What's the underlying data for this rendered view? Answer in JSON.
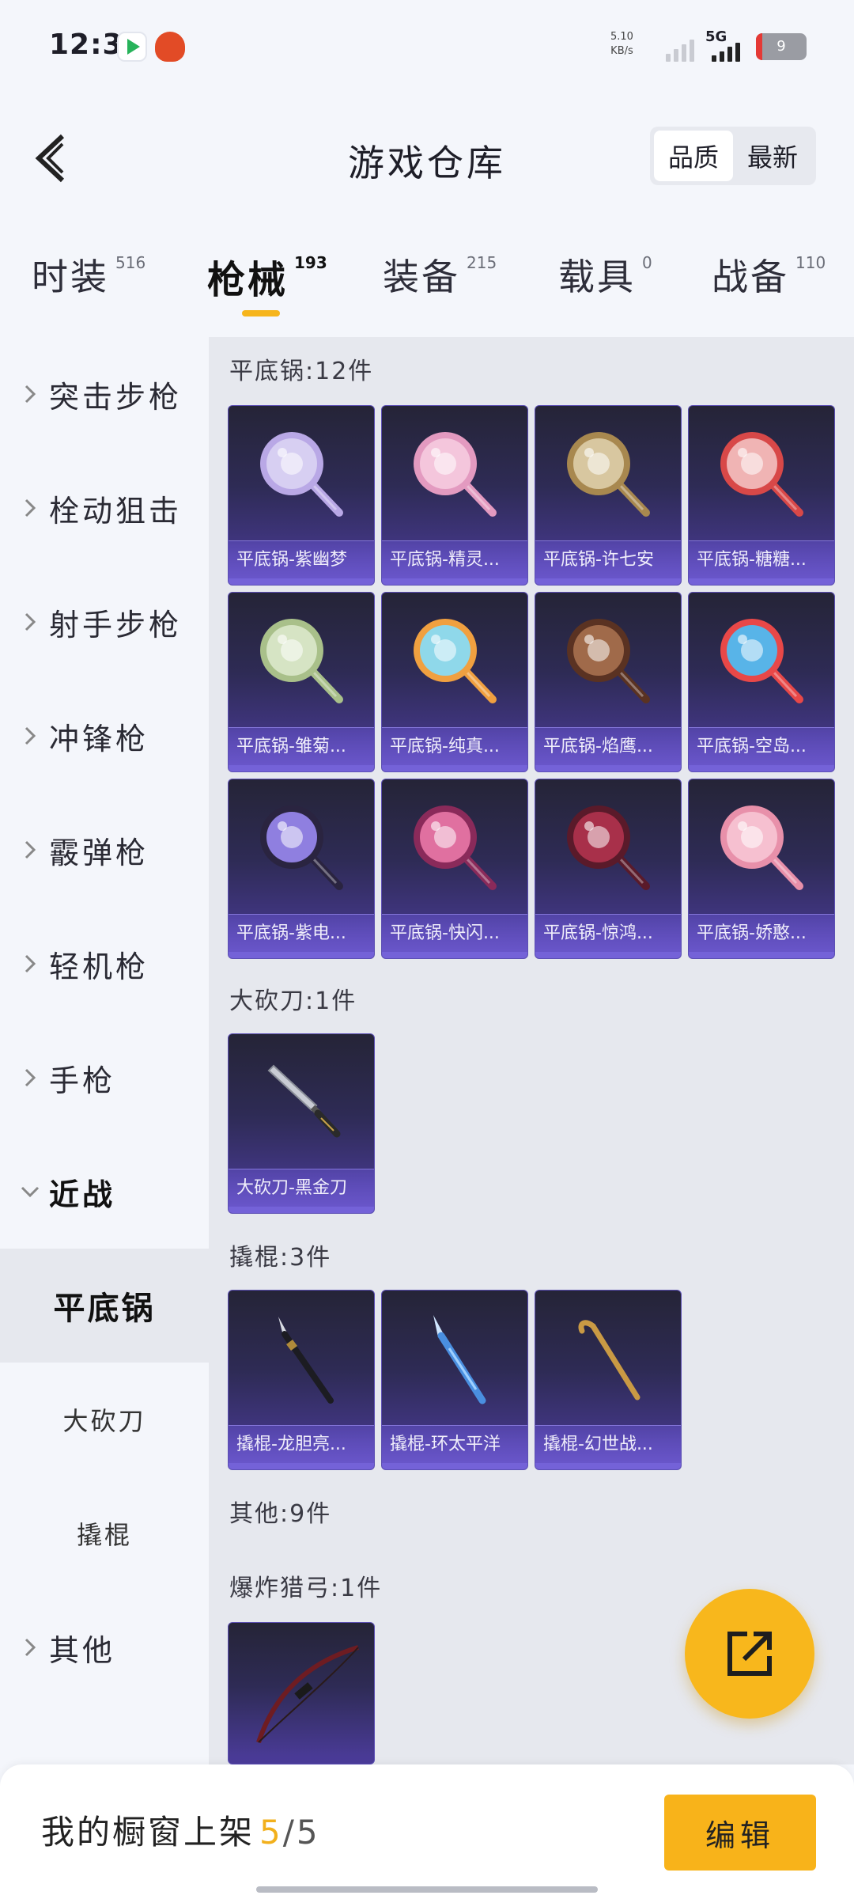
{
  "status": {
    "time": "12:31",
    "speed_value": "5.10",
    "speed_unit": "KB/s",
    "network": "5G",
    "battery": "9"
  },
  "header": {
    "title": "游戏仓库",
    "sort_options": [
      "品质",
      "最新"
    ],
    "active_sort": "品质"
  },
  "tabs": [
    {
      "label": "时装",
      "count": "516"
    },
    {
      "label": "枪械",
      "count": "193"
    },
    {
      "label": "装备",
      "count": "215"
    },
    {
      "label": "载具",
      "count": "0"
    },
    {
      "label": "战备",
      "count": "110"
    }
  ],
  "sidebar": {
    "items": [
      {
        "label": "突击步枪"
      },
      {
        "label": "栓动狙击"
      },
      {
        "label": "射手步枪"
      },
      {
        "label": "冲锋枪"
      },
      {
        "label": "霰弹枪"
      },
      {
        "label": "轻机枪"
      },
      {
        "label": "手枪"
      },
      {
        "label": "近战"
      }
    ],
    "subitems": [
      {
        "label": "平底锅"
      },
      {
        "label": "大砍刀"
      },
      {
        "label": "撬棍"
      }
    ],
    "other": {
      "label": "其他"
    }
  },
  "sections": {
    "pan": {
      "title": "平底锅:12件",
      "items": [
        {
          "label": "平底锅-紫幽梦",
          "colors": [
            "#d7cff2",
            "#b9a8e6"
          ]
        },
        {
          "label": "平底锅-精灵...",
          "colors": [
            "#f4c6dc",
            "#e39ac0"
          ]
        },
        {
          "label": "平底锅-许七安",
          "colors": [
            "#d8c7a0",
            "#a8884f"
          ]
        },
        {
          "label": "平底锅-糖糖...",
          "colors": [
            "#f0b4b4",
            "#d84848"
          ]
        },
        {
          "label": "平底锅-雏菊...",
          "colors": [
            "#d6e4c4",
            "#a9c08a"
          ]
        },
        {
          "label": "平底锅-纯真...",
          "colors": [
            "#8fd8ea",
            "#f0a040"
          ]
        },
        {
          "label": "平底锅-焰鹰...",
          "colors": [
            "#a06a4a",
            "#5a3222"
          ]
        },
        {
          "label": "平底锅-空岛...",
          "colors": [
            "#58b4e8",
            "#e84848"
          ]
        },
        {
          "label": "平底锅-紫电...",
          "colors": [
            "#8f7fe0",
            "#2a2440"
          ]
        },
        {
          "label": "平底锅-快闪...",
          "colors": [
            "#e070a0",
            "#8a2a5a"
          ]
        },
        {
          "label": "平底锅-惊鸿...",
          "colors": [
            "#a8304a",
            "#5a1a2a"
          ]
        },
        {
          "label": "平底锅-娇憨...",
          "colors": [
            "#f6c0d0",
            "#e890aa"
          ]
        }
      ]
    },
    "machete": {
      "title": "大砍刀:1件",
      "items": [
        {
          "label": "大砍刀-黑金刀"
        }
      ]
    },
    "crowbar": {
      "title": "撬棍:3件",
      "items": [
        {
          "label": "撬棍-龙胆亮..."
        },
        {
          "label": "撬棍-环太平洋"
        },
        {
          "label": "撬棍-幻世战..."
        }
      ]
    },
    "other": {
      "title": "其他:9件"
    },
    "bow": {
      "title": "爆炸猎弓:1件"
    }
  },
  "bottom": {
    "shelf_label": "我的橱窗上架",
    "shelf_count": "5",
    "shelf_sep": "/",
    "shelf_total": "5",
    "edit_label": "编辑"
  },
  "icons": {
    "back": "back-arrow-icon",
    "share": "share-out-icon",
    "chevron_right": "chevron-right-icon",
    "chevron_down": "chevron-down-icon"
  },
  "colors": {
    "accent": "#f8b31a",
    "card_top": "#252437",
    "card_bottom": "#4c3c9c"
  }
}
